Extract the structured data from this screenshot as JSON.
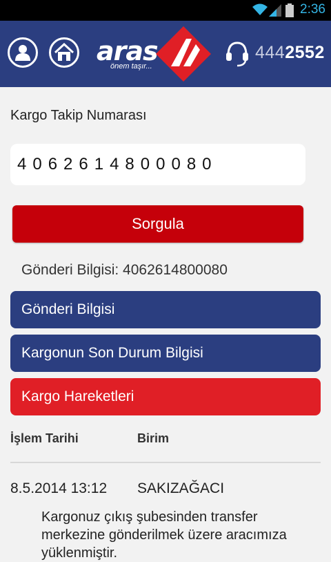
{
  "status_bar": {
    "time": "2:36"
  },
  "header": {
    "logo_text": "aras",
    "logo_slogan": "önem taşır...",
    "phone_prefix": "444",
    "phone_suffix": "2552",
    "brand_red": "#e01f26",
    "brand_blue": "#2b3e80"
  },
  "form": {
    "label": "Kargo Takip Numarası",
    "tracking_value": "4062614800080",
    "submit_label": "Sorgula"
  },
  "result": {
    "title": "Gönderi Bilgisi: 4062614800080",
    "sections": [
      "Gönderi Bilgisi",
      "Kargonun Son Durum Bilgisi",
      "Kargo Hareketleri"
    ]
  },
  "table": {
    "headers": [
      "İşlem Tarihi",
      "Birim"
    ],
    "rows": [
      {
        "date": "8.5.2014 13:12",
        "unit": "SAKIZAĞACI",
        "description": "Kargonuz çıkış şubesinden transfer merkezine gönderilmek üzere aracımıza yüklenmiştir."
      }
    ]
  }
}
